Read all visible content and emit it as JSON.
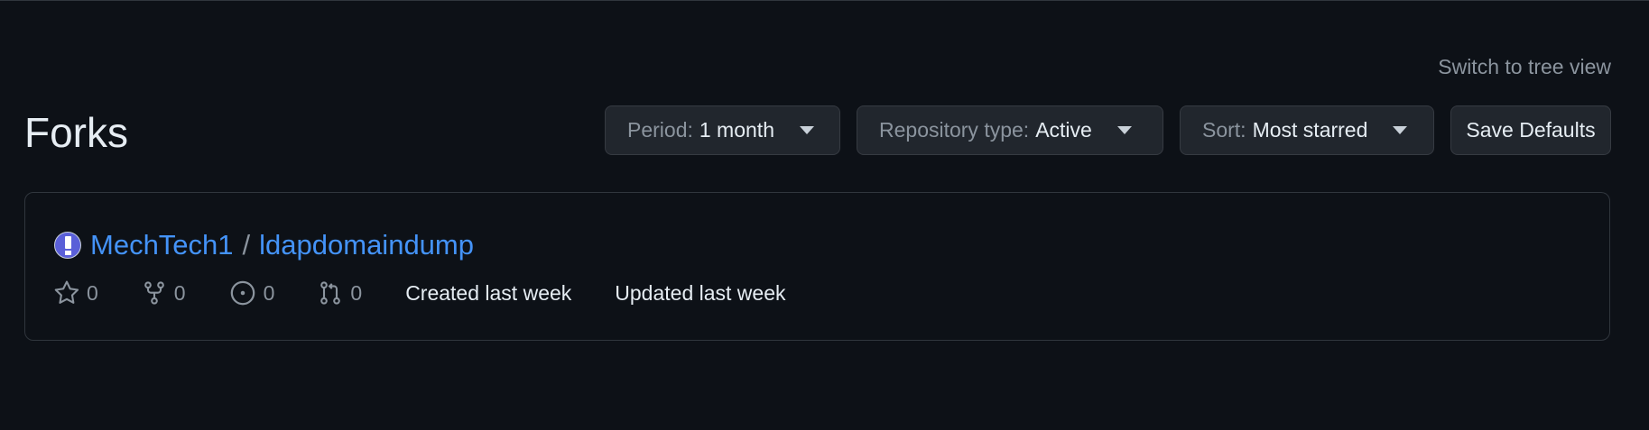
{
  "header": {
    "switch_link": "Switch to tree view",
    "title": "Forks"
  },
  "toolbar": {
    "period": {
      "label": "Period:",
      "value": "1 month"
    },
    "repo_type": {
      "label": "Repository type:",
      "value": "Active"
    },
    "sort": {
      "label": "Sort:",
      "value": "Most starred"
    },
    "save_label": "Save Defaults"
  },
  "fork": {
    "owner": "MechTech1",
    "separator": "/",
    "name": "ldapdomaindump",
    "stars": "0",
    "forks": "0",
    "issues": "0",
    "pulls": "0",
    "created": "Created last week",
    "updated": "Updated last week"
  },
  "icons": [
    "star-icon",
    "fork-icon",
    "issue-icon",
    "pull-request-icon",
    "caret-down-icon"
  ],
  "colors": {
    "background": "#0d1117",
    "link": "#4493f8",
    "muted": "#8b949e",
    "button_bg": "#21262d",
    "border": "#30363d"
  }
}
